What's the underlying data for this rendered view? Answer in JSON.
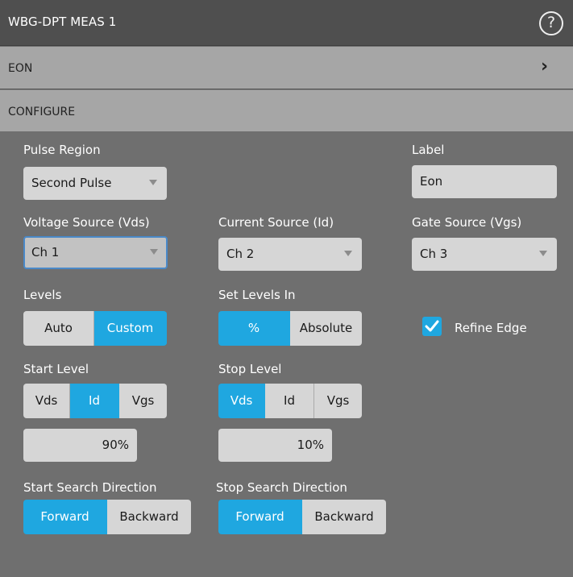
{
  "header": {
    "title": "WBG-DPT MEAS 1",
    "help_glyph": "?"
  },
  "eon_band": {
    "label": "EON",
    "chevron": "›"
  },
  "configure_band": {
    "label": "CONFIGURE"
  },
  "pulse_region": {
    "label": "Pulse Region",
    "value": "Second Pulse"
  },
  "label_field": {
    "label": "Label",
    "value": "Eon"
  },
  "voltage_source": {
    "label": "Voltage Source (Vds)",
    "value": "Ch 1"
  },
  "current_source": {
    "label": "Current Source (Id)",
    "value": "Ch 2"
  },
  "gate_source": {
    "label": "Gate Source (Vgs)",
    "value": "Ch 3"
  },
  "levels": {
    "label": "Levels",
    "options": [
      "Auto",
      "Custom"
    ],
    "selected": "Custom"
  },
  "set_levels_in": {
    "label": "Set Levels In",
    "options": [
      "%",
      "Absolute"
    ],
    "selected": "%"
  },
  "refine_edge": {
    "label": "Refine Edge",
    "checked": true
  },
  "start_level": {
    "label": "Start Level",
    "options": [
      "Vds",
      "Id",
      "Vgs"
    ],
    "selected": "Id",
    "value": "90%"
  },
  "stop_level": {
    "label": "Stop Level",
    "options": [
      "Vds",
      "Id",
      "Vgs"
    ],
    "selected": "Vds",
    "value": "10%"
  },
  "start_search_direction": {
    "label": "Start Search Direction",
    "options": [
      "Forward",
      "Backward"
    ],
    "selected": "Forward"
  },
  "stop_search_direction": {
    "label": "Stop Search Direction",
    "options": [
      "Forward",
      "Backward"
    ],
    "selected": "Forward"
  },
  "colors": {
    "accent": "#1fa7e0",
    "panel": "#6f6f6f",
    "band": "#a6a6a6",
    "titlebar": "#4f4f4f"
  }
}
